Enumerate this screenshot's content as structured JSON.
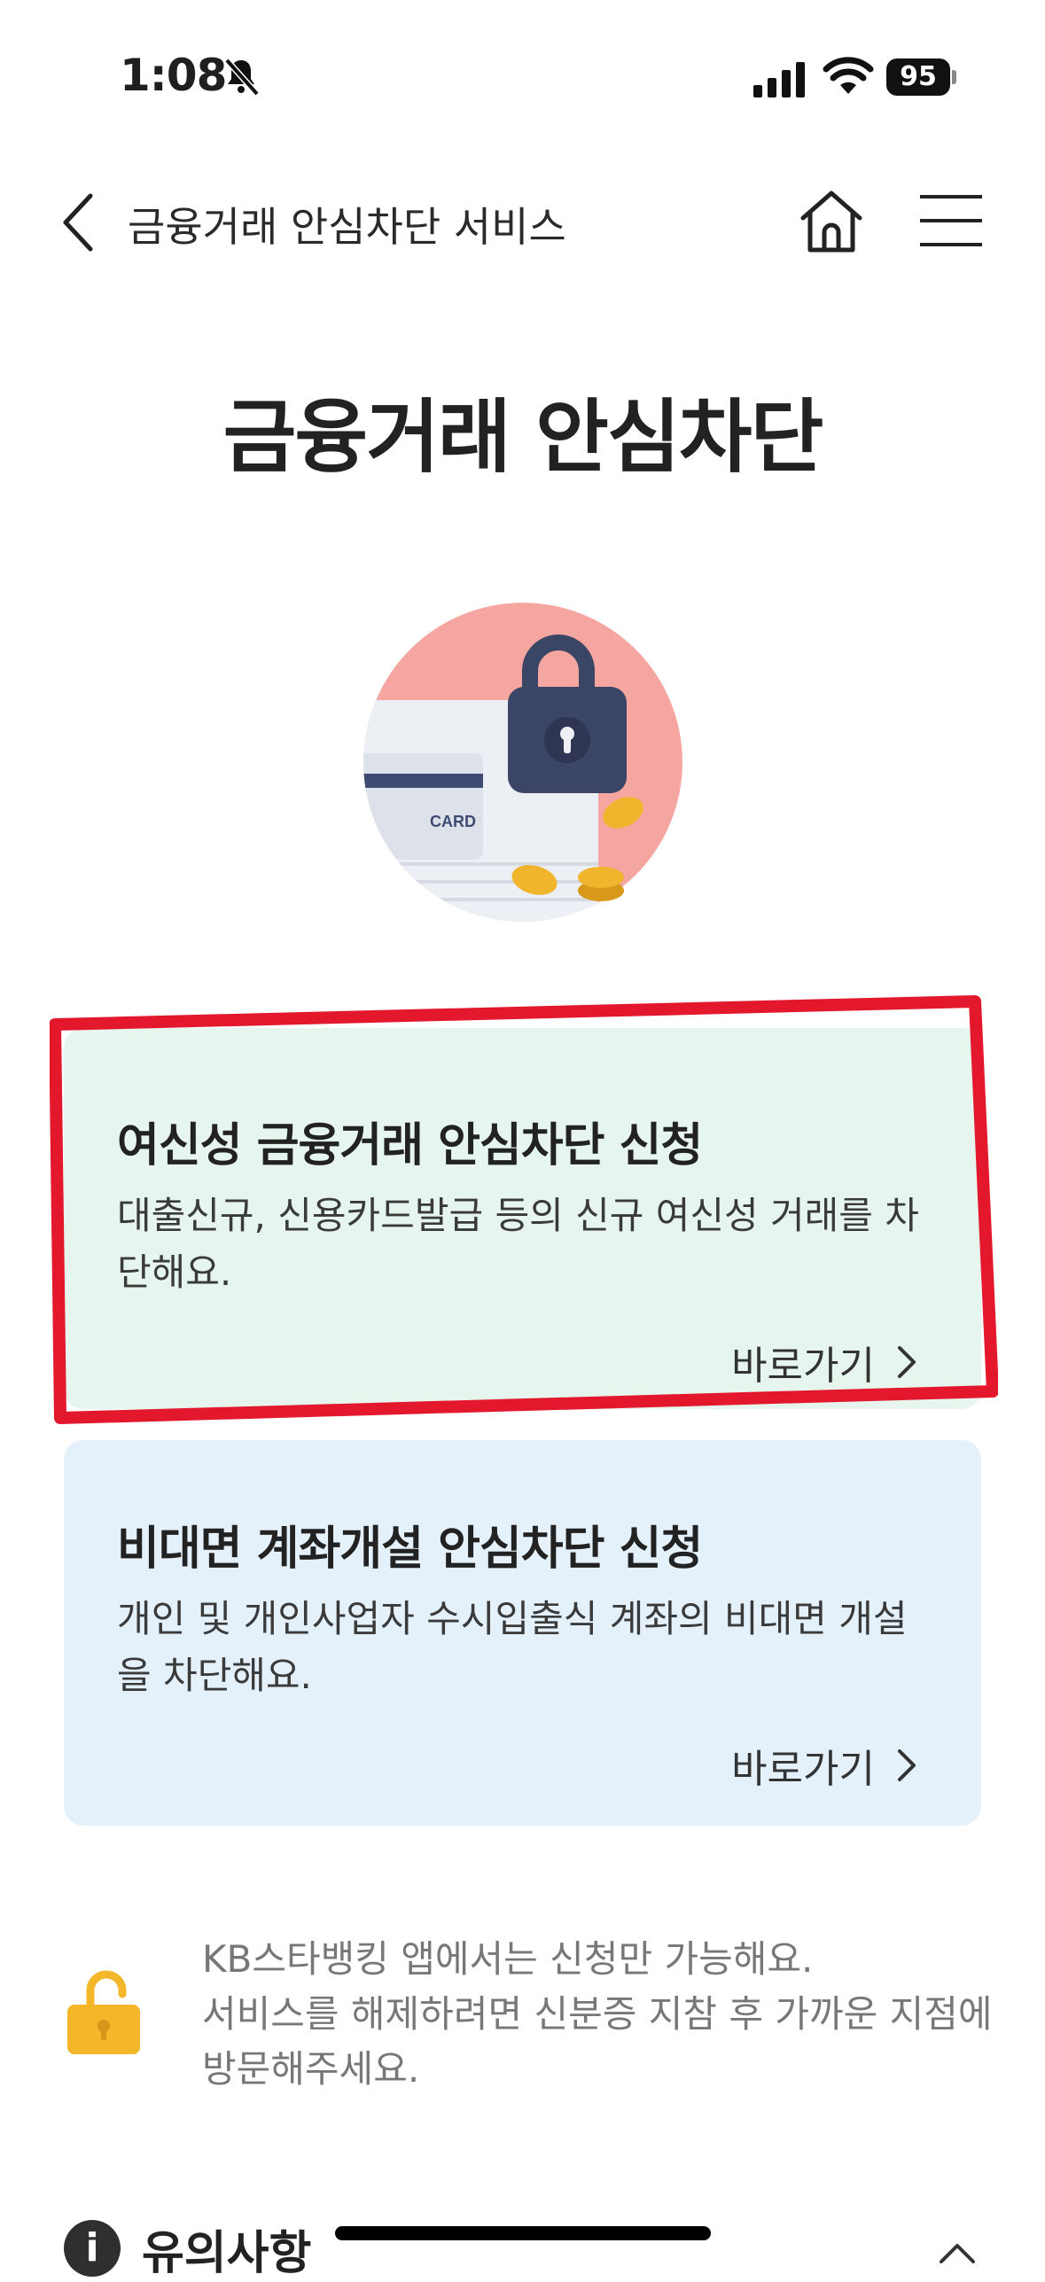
{
  "status": {
    "time": "1:08",
    "battery": "95"
  },
  "header": {
    "title": "금융거래 안심차단 서비스"
  },
  "page_title": "금융거래 안심차단",
  "illustration": {
    "card_label": "CARD"
  },
  "cards": [
    {
      "title": "여신성 금융거래 안심차단 신청",
      "desc": "대출신규, 신용카드발급 등의 신규 여신성 거래를 차단해요.",
      "link": "바로가기",
      "color": "#e6f5ee"
    },
    {
      "title": "비대면 계좌개설 안심차단 신청",
      "desc": "개인 및 개인사업자 수시입출식 계좌의 비대면 개설을 차단해요.",
      "link": "바로가기",
      "color": "#e4f1fb"
    }
  ],
  "notice": {
    "line1": "KB스타뱅킹 앱에서는 신청만 가능해요.",
    "line2": "서비스를 해제하려면 신분증 지참 후 가까운 지점에 방문해주세요."
  },
  "caution": {
    "icon": "i",
    "label": "유의사항"
  },
  "colors": {
    "highlight": "#e3182d",
    "lock_accent": "#f5b72a"
  }
}
